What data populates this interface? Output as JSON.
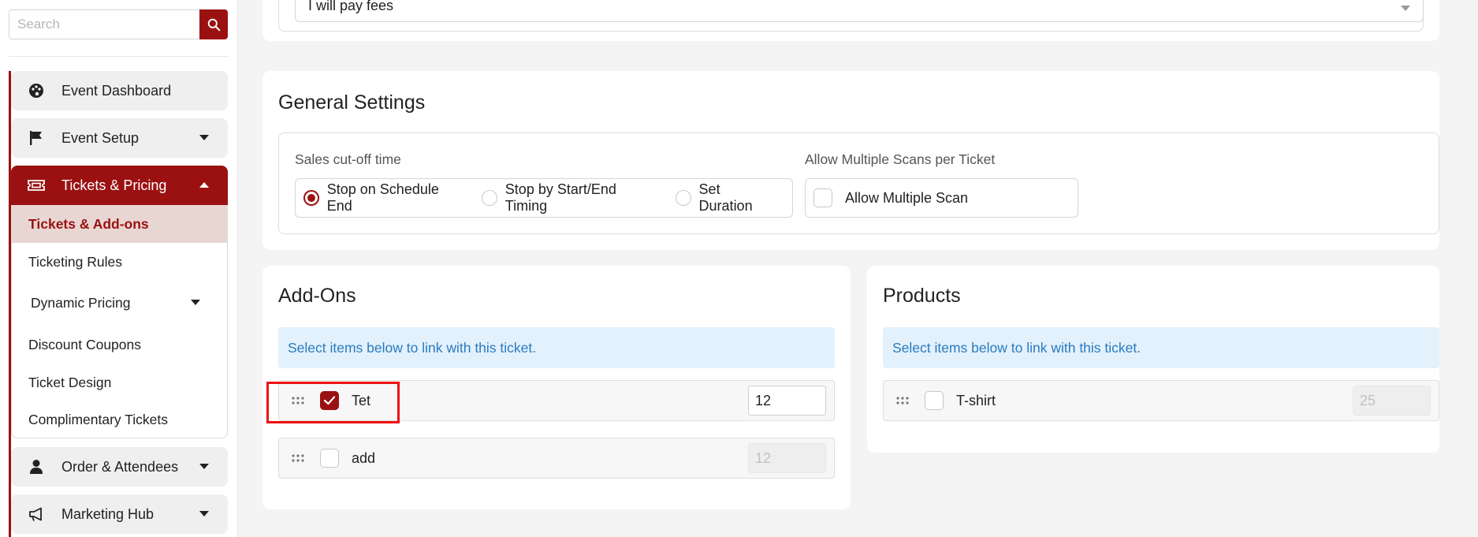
{
  "sidebar": {
    "search": {
      "placeholder": "Search",
      "value": ""
    },
    "items": [
      {
        "label": "Event Dashboard",
        "icon": "palette-icon"
      },
      {
        "label": "Event Setup",
        "icon": "flag-icon"
      },
      {
        "label": "Tickets & Pricing",
        "icon": "ticket-icon",
        "active": true
      },
      {
        "label": "Order & Attendees",
        "icon": "user-icon"
      },
      {
        "label": "Marketing Hub",
        "icon": "megaphone-icon"
      }
    ],
    "subitems": [
      {
        "label": "Tickets & Add-ons",
        "selected": true
      },
      {
        "label": "Ticketing Rules"
      },
      {
        "label": "Dynamic Pricing"
      },
      {
        "label": "Discount Coupons"
      },
      {
        "label": "Ticket Design"
      },
      {
        "label": "Complimentary Tickets"
      }
    ]
  },
  "fees": {
    "selected": "I will pay fees"
  },
  "general_settings": {
    "title": "General Settings",
    "cutoff": {
      "label": "Sales cut-off time",
      "options": [
        "Stop on Schedule End",
        "Stop by Start/End Timing",
        "Set Duration"
      ],
      "selected": "Stop on Schedule End"
    },
    "multi_scan": {
      "label": "Allow Multiple Scans per Ticket",
      "checkbox_label": "Allow Multiple Scan",
      "checked": false
    }
  },
  "addons": {
    "title": "Add-Ons",
    "info": "Select items below to link with this ticket.",
    "items": [
      {
        "label": "Tet",
        "checked": true,
        "qty": "12"
      },
      {
        "label": "add",
        "checked": false,
        "qty": "12"
      }
    ]
  },
  "products": {
    "title": "Products",
    "info": "Select items below to link with this ticket.",
    "items": [
      {
        "label": "T-shirt",
        "checked": false,
        "qty": "25"
      }
    ]
  },
  "colors": {
    "brand": "#9b1111",
    "selected_bg": "#e8d6d3",
    "info_bg": "#e3f1fc",
    "info_text": "#2a7bc0",
    "highlight": "#ee1111"
  }
}
